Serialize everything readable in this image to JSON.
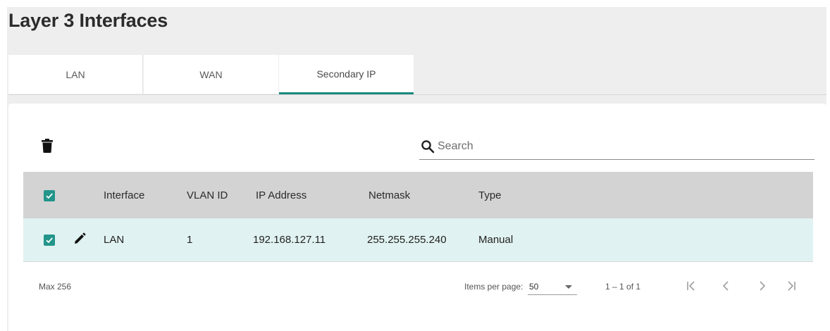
{
  "page": {
    "title": "Layer 3 Interfaces"
  },
  "tabs": [
    {
      "label": "LAN",
      "active": false
    },
    {
      "label": "WAN",
      "active": false
    },
    {
      "label": "Secondary IP",
      "active": true
    }
  ],
  "toolbar": {
    "delete_icon": "trash-icon"
  },
  "search": {
    "placeholder": "Search",
    "value": ""
  },
  "table": {
    "columns": [
      "Interface",
      "VLAN ID",
      "IP Address",
      "Netmask",
      "Type"
    ],
    "rows": [
      {
        "interface": "LAN",
        "vlan_id": "1",
        "ip_address": "192.168.127.11",
        "netmask": "255.255.255.240",
        "type": "Manual",
        "checked": true
      }
    ],
    "select_all_checked": true
  },
  "footer": {
    "max_label": "Max 256",
    "items_per_page_label": "Items per page:",
    "items_per_page_value": "50",
    "range_label": "1 – 1 of 1"
  },
  "colors": {
    "accent": "#23958a",
    "tab_indicator": "#1a8a80",
    "row_selected": "#e0f2f1",
    "header_bg": "#d3d3d3"
  }
}
